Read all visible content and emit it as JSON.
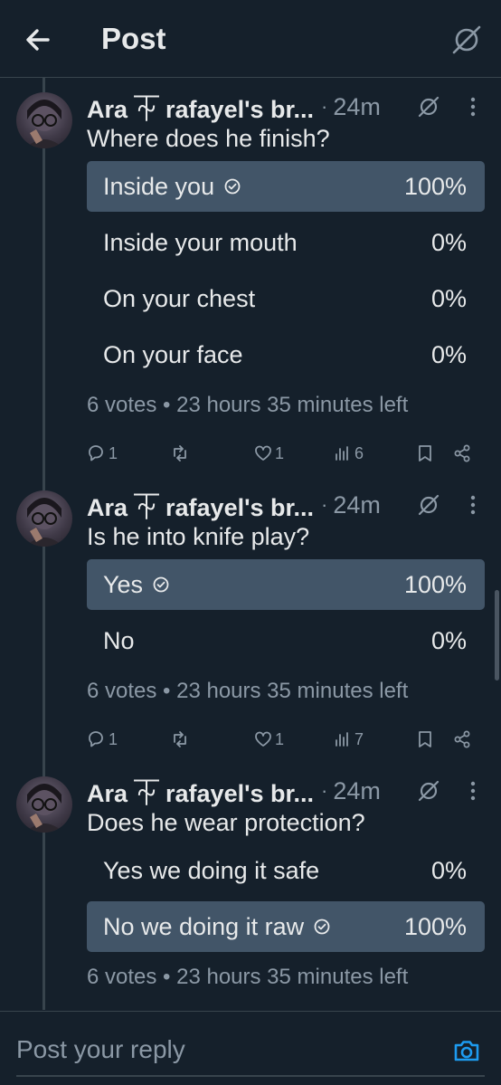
{
  "header": {
    "title": "Post",
    "back_icon": "arrow-left-icon",
    "right_icon": "muted-circle-icon"
  },
  "posts": [
    {
      "author": "Ara ⏇ rafayel's br...",
      "time": "24m",
      "question": "Where does he finish?",
      "options": [
        {
          "label": "Inside you",
          "percent": "100%",
          "value": 1.0,
          "selected": true
        },
        {
          "label": "Inside your mouth",
          "percent": "0%",
          "value": 0,
          "selected": false
        },
        {
          "label": "On your chest",
          "percent": "0%",
          "value": 0,
          "selected": false
        },
        {
          "label": "On your face",
          "percent": "0%",
          "value": 0,
          "selected": false
        }
      ],
      "meta": "6 votes • 23 hours 35 minutes left",
      "actions": {
        "replies": "1",
        "reposts": "",
        "likes": "1",
        "views": "6"
      }
    },
    {
      "author": "Ara ⏇ rafayel's br...",
      "time": "24m",
      "question": "Is he into knife play?",
      "options": [
        {
          "label": "Yes",
          "percent": "100%",
          "value": 1.0,
          "selected": true
        },
        {
          "label": "No",
          "percent": "0%",
          "value": 0,
          "selected": false
        }
      ],
      "meta": "6 votes • 23 hours 35 minutes left",
      "actions": {
        "replies": "1",
        "reposts": "",
        "likes": "1",
        "views": "7"
      }
    },
    {
      "author": "Ara ⏇ rafayel's br...",
      "time": "24m",
      "question": "Does he wear protection?",
      "options": [
        {
          "label": "Yes we doing it safe",
          "percent": "0%",
          "value": 0,
          "selected": false
        },
        {
          "label": "No we doing it raw",
          "percent": "100%",
          "value": 1.0,
          "selected": true
        }
      ],
      "meta": "6 votes • 23 hours 35 minutes left"
    }
  ],
  "reply": {
    "placeholder": "Post your reply"
  },
  "colors": {
    "background": "#15202b",
    "poll_fill": "#425568",
    "text_secondary": "#8b98a5",
    "accent": "#1d9bf0"
  }
}
